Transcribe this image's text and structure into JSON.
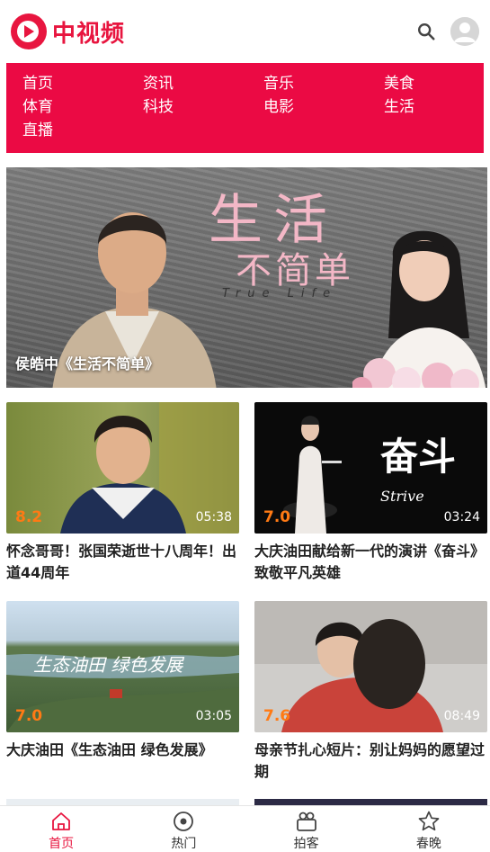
{
  "app": {
    "logo_text": "中视频"
  },
  "nav": {
    "items": [
      {
        "label": "首页"
      },
      {
        "label": "资讯"
      },
      {
        "label": "音乐"
      },
      {
        "label": "美食"
      },
      {
        "label": "体育"
      },
      {
        "label": "科技"
      },
      {
        "label": "电影"
      },
      {
        "label": "生活"
      },
      {
        "label": "直播"
      }
    ]
  },
  "hero": {
    "art_title": "生活",
    "art_subtitle": "不简单",
    "art_english": "True Life",
    "caption": "侯皓中《生活不简单》"
  },
  "videos": [
    {
      "score": "8.2",
      "duration": "05:38",
      "title": "怀念哥哥！张国荣逝世十八周年！出道44周年"
    },
    {
      "score": "7.0",
      "duration": "03:24",
      "title": "大庆油田献给新一代的演讲《奋斗》 致敬平凡英雄",
      "art_text": "奋斗",
      "art_en": "Strive"
    },
    {
      "score": "7.0",
      "duration": "03:05",
      "title": "大庆油田《生态油田 绿色发展》",
      "art_text": "生态油田  绿色发展"
    },
    {
      "score": "7.6",
      "duration": "08:49",
      "title": "母亲节扎心短片：别让妈妈的愿望过期"
    }
  ],
  "tabbar": {
    "items": [
      {
        "label": "首页",
        "icon": "home-icon",
        "active": true
      },
      {
        "label": "热门",
        "icon": "hot-icon"
      },
      {
        "label": "拍客",
        "icon": "camera-icon"
      },
      {
        "label": "春晚",
        "icon": "star-icon"
      }
    ]
  },
  "colors": {
    "brand": "#e8153f",
    "nav_bg": "#eb0a44",
    "score": "#ff7a14"
  }
}
